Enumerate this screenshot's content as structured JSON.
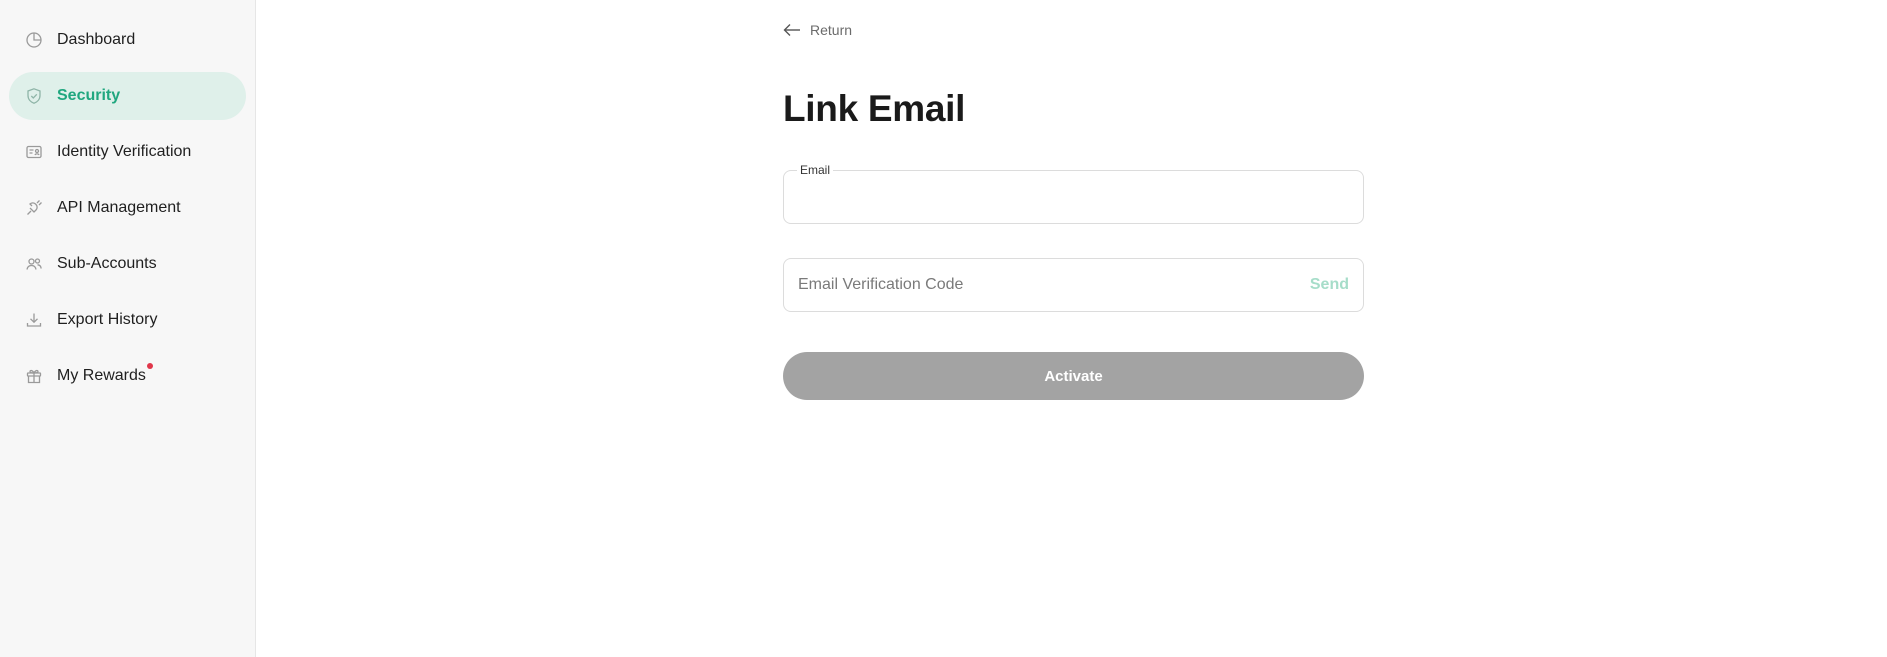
{
  "sidebar": {
    "items": [
      {
        "label": "Dashboard",
        "icon": "dashboard-pie-icon",
        "active": false
      },
      {
        "label": "Security",
        "icon": "shield-icon",
        "active": true
      },
      {
        "label": "Identity Verification",
        "icon": "id-card-icon",
        "active": false
      },
      {
        "label": "API Management",
        "icon": "api-plug-icon",
        "active": false
      },
      {
        "label": "Sub-Accounts",
        "icon": "users-icon",
        "active": false
      },
      {
        "label": "Export History",
        "icon": "download-icon",
        "active": false
      },
      {
        "label": "My Rewards",
        "icon": "gift-icon",
        "active": false,
        "notification_dot": true
      }
    ]
  },
  "main": {
    "return_label": "Return",
    "title": "Link Email",
    "email_field": {
      "label": "Email",
      "value": "",
      "placeholder": ""
    },
    "code_field": {
      "value": "",
      "placeholder": "Email Verification Code",
      "send_label": "Send"
    },
    "activate_label": "Activate"
  },
  "colors": {
    "accent": "#20a77f",
    "active_bg": "#dff0ea",
    "send_disabled": "#a6ddc9",
    "button_disabled": "#a3a3a3",
    "notification_dot": "#e0364a"
  }
}
